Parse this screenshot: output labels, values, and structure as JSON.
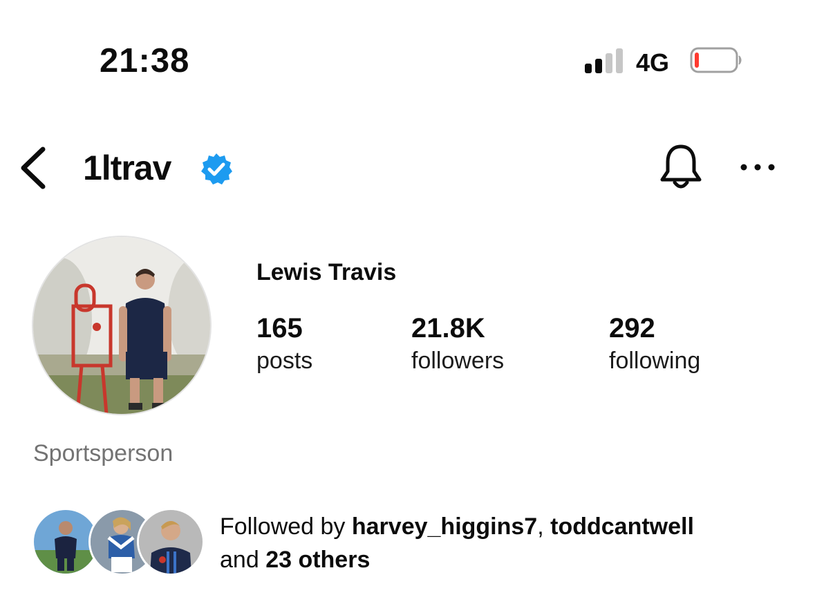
{
  "status_bar": {
    "time": "21:38",
    "network": "4G",
    "signal_bars_active": 2,
    "signal_bars_total": 4,
    "battery_level": 0.08,
    "battery_color": "#ff3b30"
  },
  "header": {
    "back_icon": "chevron-left-icon",
    "username": "1ltrav",
    "verified_icon": "verified-badge-icon",
    "verified_color": "#1d9bf0",
    "bell_icon": "bell-icon",
    "more_icon": "more-horizontal-icon"
  },
  "profile": {
    "full_name": "Lewis Travis",
    "avatar_icon": "profile-avatar",
    "stats": [
      {
        "value": "165",
        "label": "posts"
      },
      {
        "value": "21.8K",
        "label": "followers"
      },
      {
        "value": "292",
        "label": "following"
      }
    ],
    "category": "Sportsperson"
  },
  "followed_by": {
    "prefix": "Followed by ",
    "user1": "harvey_higgins7",
    "separator": ", ",
    "user2": "toddcantwell",
    "middle": "and ",
    "others": "23 others"
  }
}
